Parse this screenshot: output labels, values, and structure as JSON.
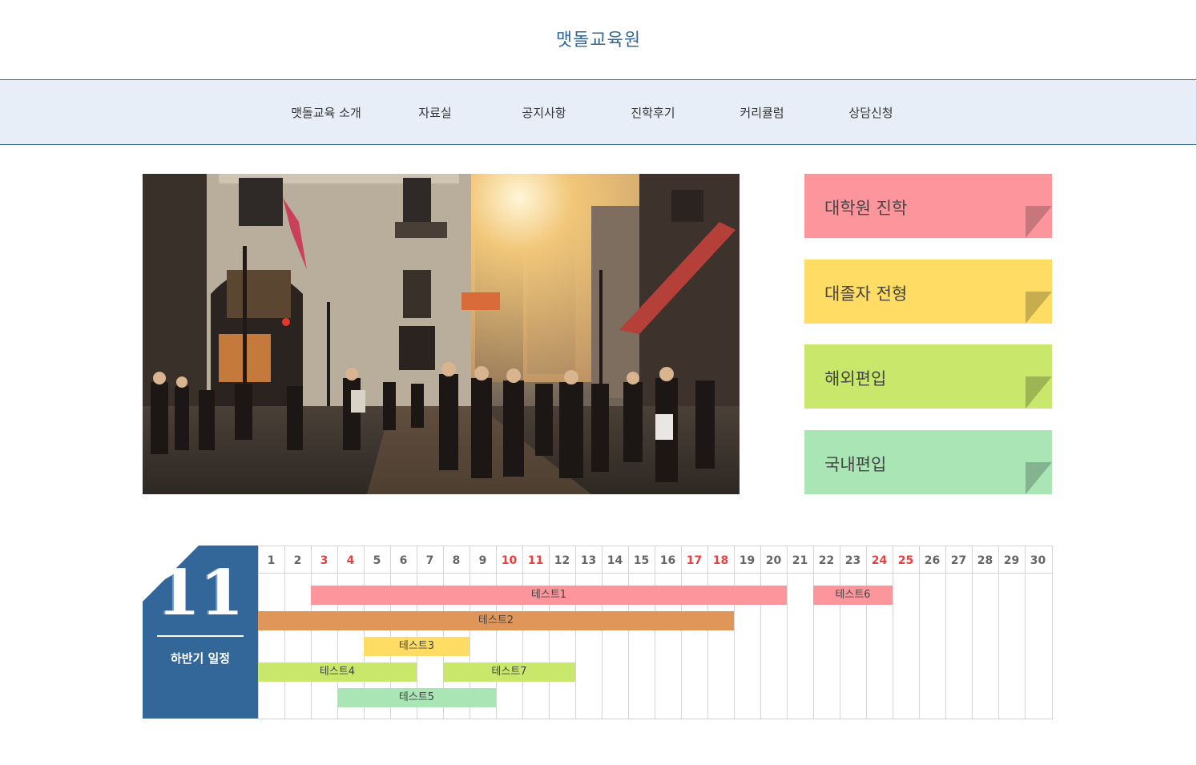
{
  "header": {
    "title": "맷돌교육원"
  },
  "nav": {
    "items": [
      {
        "label": "맷돌교육 소개"
      },
      {
        "label": "자료실"
      },
      {
        "label": "공지사항"
      },
      {
        "label": "진학후기"
      },
      {
        "label": "커리큘럼"
      },
      {
        "label": "상담신청"
      }
    ]
  },
  "cards": [
    {
      "label": "대학원 진학",
      "color": "#fc959c",
      "fold": "#c7767c"
    },
    {
      "label": "대졸자 전형",
      "color": "#ffdc63",
      "fold": "#c8ad4e"
    },
    {
      "label": "해외편입",
      "color": "#c9e76a",
      "fold": "#9eb554"
    },
    {
      "label": "국내편입",
      "color": "#a9e5b5",
      "fold": "#84b38f"
    }
  ],
  "calendar": {
    "month": "11",
    "subtitle": "하반기 일정",
    "accent": "#336699",
    "days": [
      "1",
      "2",
      "3",
      "4",
      "5",
      "6",
      "7",
      "8",
      "9",
      "10",
      "11",
      "12",
      "13",
      "14",
      "15",
      "16",
      "17",
      "18",
      "19",
      "20",
      "21",
      "22",
      "23",
      "24",
      "25",
      "26",
      "27",
      "28",
      "29",
      "30"
    ],
    "holidays": [
      3,
      4,
      10,
      11,
      17,
      18,
      24,
      25
    ],
    "events": [
      {
        "label": "테스트1",
        "start": 3,
        "end": 20,
        "color": "#fc959c"
      },
      {
        "label": "테스트6",
        "start": 22,
        "end": 24,
        "color": "#fc959c"
      },
      {
        "label": "테스트2",
        "start": 1,
        "end": 18,
        "color": "#e19659"
      },
      {
        "label": "테스트3",
        "start": 5,
        "end": 8,
        "color": "#ffdc63"
      },
      {
        "label": "테스트4",
        "start": 1,
        "end": 6,
        "color": "#c9e76a"
      },
      {
        "label": "테스트7",
        "start": 8,
        "end": 12,
        "color": "#c9e76a"
      },
      {
        "label": "테스트5",
        "start": 4,
        "end": 9,
        "color": "#a9e5b5"
      }
    ]
  }
}
